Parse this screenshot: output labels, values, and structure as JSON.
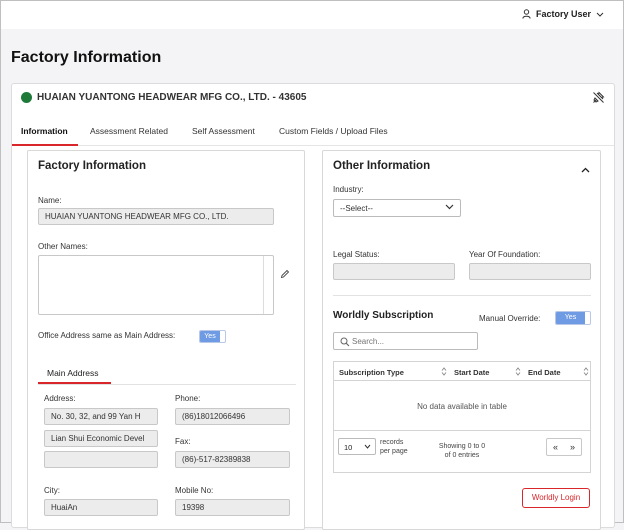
{
  "header": {
    "user_menu_label": "Factory User"
  },
  "page": {
    "title": "Factory Information"
  },
  "factory": {
    "name_header": "HUAIAN YUANTONG HEADWEAR MFG CO., LTD. - 43605"
  },
  "tabs": [
    {
      "label": "Information",
      "active": true
    },
    {
      "label": "Assessment Related",
      "active": false
    },
    {
      "label": "Self Assessment",
      "active": false
    },
    {
      "label": "Custom Fields / Upload Files",
      "active": false
    }
  ],
  "left_panel": {
    "title": "Factory Information",
    "name_label": "Name:",
    "name_value": "HUAIAN YUANTONG HEADWEAR MFG CO., LTD.",
    "other_names_label": "Other Names:",
    "office_same_label": "Office Address same as Main Address:",
    "office_same_toggle": "Yes",
    "address_tab": "Main Address",
    "address_label": "Address:",
    "address_line1": "No. 30, 32, and 99  Yan H",
    "address_line2": "Lian Shui Economic Devel",
    "address_line3": "",
    "phone_label": "Phone:",
    "phone_value": "(86)18012066496",
    "fax_label": "Fax:",
    "fax_value": "(86)-517-82389838",
    "city_label": "City:",
    "city_value": "HuaiAn",
    "mobile_label": "Mobile No:",
    "mobile_value": "19398"
  },
  "right_panel": {
    "title": "Other Information",
    "industry_label": "Industry:",
    "industry_selected": "--Select--",
    "legal_status_label": "Legal Status:",
    "legal_status_value": "",
    "year_label": "Year Of Foundation:",
    "year_value": "",
    "worldly_title": "Worldly Subscription",
    "manual_override_label": "Manual Override:",
    "manual_override_toggle": "Yes",
    "search_placeholder": "Search...",
    "columns": [
      "Subscription Type",
      "Start Date",
      "End Date"
    ],
    "no_data": "No data available in table",
    "page_size": "10",
    "records_per_page": "records\nper page",
    "showing_line1": "Showing 0 to 0",
    "showing_line2": "of 0 entries",
    "prev_glyph": "«",
    "next_glyph": "»",
    "login_button": "Worldly Login"
  },
  "colors": {
    "accent_red": "#d9262a",
    "status_green": "#1f7a3a",
    "toggle_blue": "#6f9be4"
  }
}
